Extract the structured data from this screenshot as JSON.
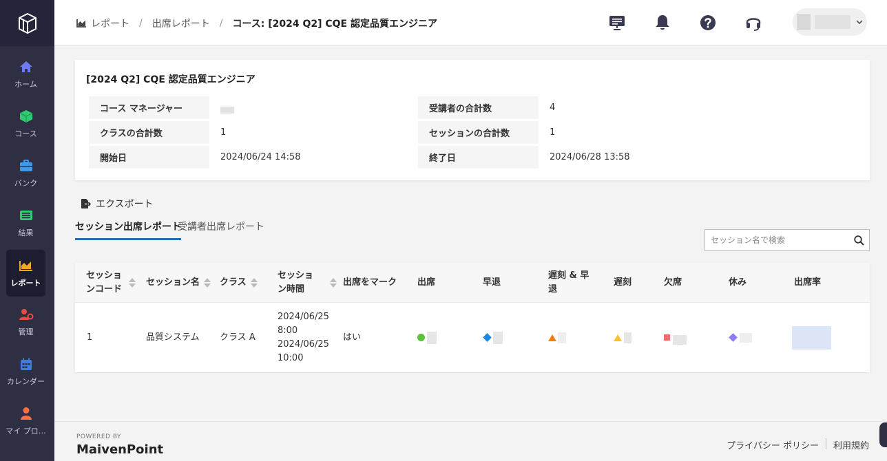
{
  "sidebar": {
    "items": [
      {
        "label": "ホーム",
        "icon": "home-icon",
        "color": "#6d7cf5"
      },
      {
        "label": "コース",
        "icon": "cube-icon",
        "color": "#2ecc71"
      },
      {
        "label": "バンク",
        "icon": "briefcase-icon",
        "color": "#3d9be9"
      },
      {
        "label": "結果",
        "icon": "list-icon",
        "color": "#2ecc71"
      },
      {
        "label": "レポート",
        "icon": "chart-icon",
        "color": "#f5a623"
      },
      {
        "label": "管理",
        "icon": "user-gear-icon",
        "color": "#e74c3c"
      },
      {
        "label": "カレンダー",
        "icon": "calendar-icon",
        "color": "#3d7be9"
      },
      {
        "label": "マイ プロ…",
        "icon": "person-icon",
        "color": "#ff7043"
      }
    ]
  },
  "breadcrumb": {
    "item1": "レポート",
    "item2": "出席レポート",
    "current": "コース: [2024 Q2] CQE 認定品質エンジニア"
  },
  "course": {
    "title": "[2024 Q2] CQE 認定品質エンジニア",
    "manager_label": "コース マネージャー",
    "trainees_label": "受講者の合計数",
    "trainees_value": "4",
    "classes_label": "クラスの合計数",
    "classes_value": "1",
    "sessions_label": "セッションの合計数",
    "sessions_value": "1",
    "start_label": "開始日",
    "start_value": "2024/06/24 14:58",
    "end_label": "終了日",
    "end_value": "2024/06/28 13:58"
  },
  "export_label": "エクスポート",
  "tabs": [
    "セッション出席レポート",
    "受講者出席レポート"
  ],
  "search": {
    "placeholder": "セッション名で検索"
  },
  "table": {
    "headers": [
      "セッションコード",
      "セッション名",
      "クラス",
      "セッション時間",
      "出席をマーク",
      "出席",
      "早退",
      "遅刻 & 早退",
      "遅刻",
      "欠席",
      "休み",
      "出席率"
    ],
    "rows": [
      {
        "code": "1",
        "name": "品質システム",
        "class": "クラス A",
        "time_start": "2024/06/25 8:00",
        "time_end": "2024/06/25 10:00",
        "mark": "はい"
      }
    ]
  },
  "colors": {
    "attend": "#5cc13a",
    "early": "#1e88e5",
    "late_early": "#f57c00",
    "late": "#fbc02d",
    "absent": "#ef6c6c",
    "rest": "#8e7cf5",
    "tab_accent": "#1f6fb5"
  },
  "footer": {
    "powered": "POWERED BY",
    "brand": "MaivenPoint",
    "privacy": "プライバシー ポリシー",
    "terms": "利用規約"
  }
}
